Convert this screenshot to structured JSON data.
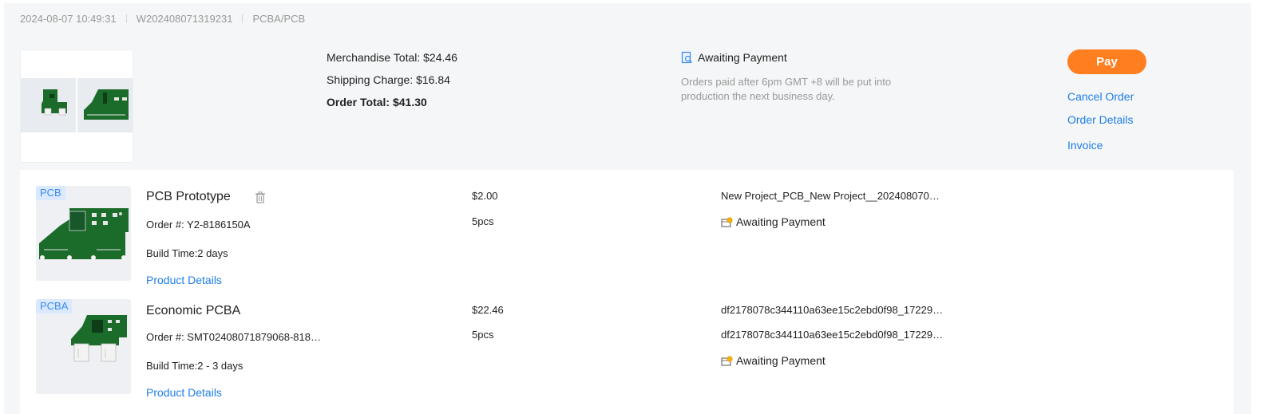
{
  "order": {
    "datetime": "2024-08-07 10:49:31",
    "number": "W202408071319231",
    "type": "PCBA/PCB",
    "merchandise_total": "Merchandise Total: $24.46",
    "shipping_charge": "Shipping Charge: $16.84",
    "order_total": "Order Total: $41.30",
    "status": "Awaiting Payment",
    "status_note": "Orders paid after 6pm GMT +8 will be put into production the next business day.",
    "actions": {
      "pay": "Pay",
      "cancel": "Cancel Order",
      "details": "Order Details",
      "invoice": "Invoice"
    }
  },
  "items": [
    {
      "tag": "PCB",
      "title": "PCB Prototype",
      "order_no": "Order #: Y2-8186150A",
      "build_time": "Build Time:2 days",
      "link": "Product Details",
      "price": "$2.00",
      "qty": "5pcs",
      "file1": "New Project_PCB_New Project__202408070…",
      "status": "Awaiting Payment"
    },
    {
      "tag": "PCBA",
      "title": "Economic PCBA",
      "order_no": "Order #: SMT02408071879068-818…",
      "build_time": "Build Time:2 - 3 days",
      "link": "Product Details",
      "price": "$22.46",
      "qty": "5pcs",
      "file1": "df2178078c344110a63ee15c2ebd0f98_17229…",
      "file2": "df2178078c344110a63ee15c2ebd0f98_17229…",
      "status": "Awaiting Payment"
    }
  ],
  "colors": {
    "accent_orange": "#ff7e1f",
    "link_blue": "#1e7ee8",
    "pcb_green": "#1b6b2a",
    "tag_bg": "#dbe9ff"
  },
  "icons": {
    "status_header": "doc-search-icon",
    "item_status": "wallet-coin-icon",
    "delete": "trash-icon"
  }
}
